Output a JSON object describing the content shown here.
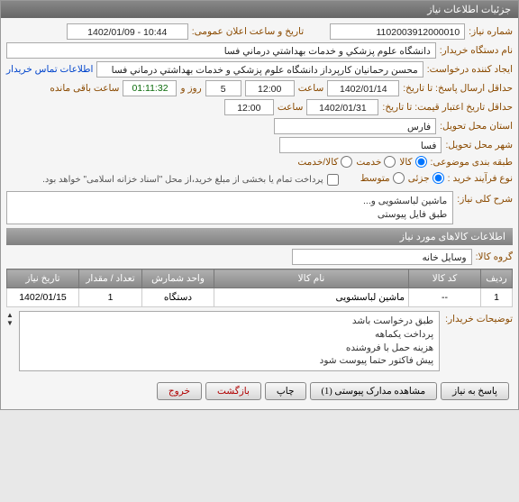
{
  "panel_title": "جزئیات اطلاعات نیاز",
  "fields": {
    "need_no_label": "شماره نیاز:",
    "need_no": "1102003912000010",
    "announce_label": "تاریخ و ساعت اعلان عمومی:",
    "announce_val": "1402/01/09 - 10:44",
    "buyer_org_label": "نام دستگاه خریدار:",
    "buyer_org": "دانشگاه علوم پزشکي و خدمات بهداشتي درماني فسا",
    "creator_label": "ایجاد کننده درخواست:",
    "creator": "محسن رحمانيان کارپرداز دانشگاه علوم پزشکي و خدمات بهداشتي درماني فسا",
    "contact_link": "اطلاعات تماس خریدار",
    "deadline_label": "حداقل ارسال پاسخ: تا تاریخ:",
    "deadline_date": "1402/01/14",
    "saat": "ساعت",
    "deadline_time": "12:00",
    "rooz_va": "روز و",
    "days_left": "5",
    "countdown": "01:11:32",
    "remaining": "ساعت باقی مانده",
    "validity_label": "حداقل تاریخ اعتبار قیمت: تا تاریخ:",
    "validity_date": "1402/01/31",
    "validity_time": "12:00",
    "province_label": "استان محل تحویل:",
    "province": "فارس",
    "city_label": "شهر محل تحویل:",
    "city": "فسا",
    "category_label": "طبقه بندی موضوعی:",
    "cat_goods": "کالا",
    "cat_service": "خدمت",
    "cat_both": "کالا/خدمت",
    "buy_type_label": "نوع فرآیند خرید :",
    "bt_partial": "جزئی",
    "bt_medium": "متوسط",
    "payment_note": "پرداخت تمام یا بخشی از مبلغ خرید،از محل \"اسناد خزانه اسلامی\" خواهد بود."
  },
  "need_desc": {
    "label": "شرح کلی نیاز:",
    "line1": "ماشین لباسشویی و...",
    "line2": "طبق فایل پیوستی"
  },
  "items_section": {
    "header": "اطلاعات کالاهای مورد نیاز",
    "group_label": "گروه کالا:",
    "group_val": "وسایل خانه"
  },
  "table": {
    "headers": [
      "ردیف",
      "کد کالا",
      "نام کالا",
      "واحد شمارش",
      "تعداد / مقدار",
      "تاریخ نیاز"
    ],
    "row": [
      "1",
      "--",
      "ماشین لباسشویی",
      "دستگاه",
      "1",
      "1402/01/15"
    ]
  },
  "buyer_notes": {
    "label": "توضیحات خریدار:",
    "lines": [
      "طبق درخواست باشد",
      "پرداخت یکماهه",
      "هزینه حمل با فروشنده",
      "پیش فاکتور حتما پیوست شود"
    ]
  },
  "buttons": {
    "respond": "پاسخ به نیاز",
    "attachments": "مشاهده مدارک پیوستی (1)",
    "print": "چاپ",
    "back": "بازگشت",
    "exit": "خروج"
  }
}
